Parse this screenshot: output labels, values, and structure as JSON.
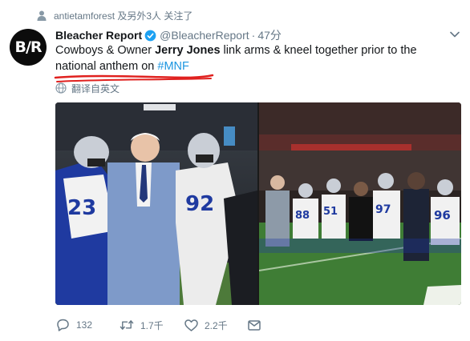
{
  "social_context": {
    "text": "antietamforest 及另外3人 关注了",
    "icon": "person-icon"
  },
  "tweet": {
    "author": {
      "name": "Bleacher Report",
      "handle": "@BleacherReport",
      "avatar_text": "B/R",
      "verified": true
    },
    "separator": "·",
    "time": "47分",
    "text": {
      "part1": "Cowboys & Owner ",
      "mention": "Jerry Jones",
      "part2": " link arms & kneel together prior to the national anthem on ",
      "hashtag": "#MNF"
    },
    "translate": "翻译自英文",
    "media": {
      "count": 2
    },
    "actions": {
      "replies": "132",
      "retweets": "1.7千",
      "likes": "2.2千"
    }
  },
  "colors": {
    "link": "#1b95e0",
    "muted": "#657786",
    "annotation": "#e0211f",
    "verified": "#1da1f2"
  }
}
